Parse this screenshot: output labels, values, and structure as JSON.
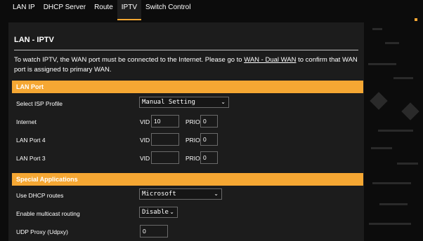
{
  "tabs": [
    {
      "label": "LAN IP"
    },
    {
      "label": "DHCP Server"
    },
    {
      "label": "Route"
    },
    {
      "label": "IPTV"
    },
    {
      "label": "Switch Control"
    }
  ],
  "panel": {
    "title": "LAN - IPTV",
    "description_before": "To watch IPTV, the WAN port must be connected to the Internet. Please go to ",
    "description_link": "WAN - Dual WAN",
    "description_after": " to confirm that WAN port is assigned to primary WAN."
  },
  "lan_port": {
    "section_title": "LAN Port",
    "isp_profile_label": "Select ISP Profile",
    "isp_profile_value": "Manual Setting",
    "vid_label": "VID",
    "prio_label": "PRIO",
    "rows": [
      {
        "label": "Internet",
        "vid": "10",
        "prio": "0"
      },
      {
        "label": "LAN Port 4",
        "vid": "",
        "prio": "0"
      },
      {
        "label": "LAN Port 3",
        "vid": "",
        "prio": "0"
      }
    ]
  },
  "special_apps": {
    "section_title": "Special Applications",
    "dhcp_routes_label": "Use DHCP routes",
    "dhcp_routes_value": "Microsoft",
    "multicast_label": "Enable multicast routing",
    "multicast_value": "Disable",
    "udp_proxy_label": "UDP Proxy (Udpxy)",
    "udp_proxy_value": "0"
  },
  "colors": {
    "accent": "#f5a733",
    "panel_bg": "#1c1c1c",
    "page_bg": "#0c0c0c"
  },
  "icons": {
    "select_chevron": "chevron-down-icon"
  }
}
